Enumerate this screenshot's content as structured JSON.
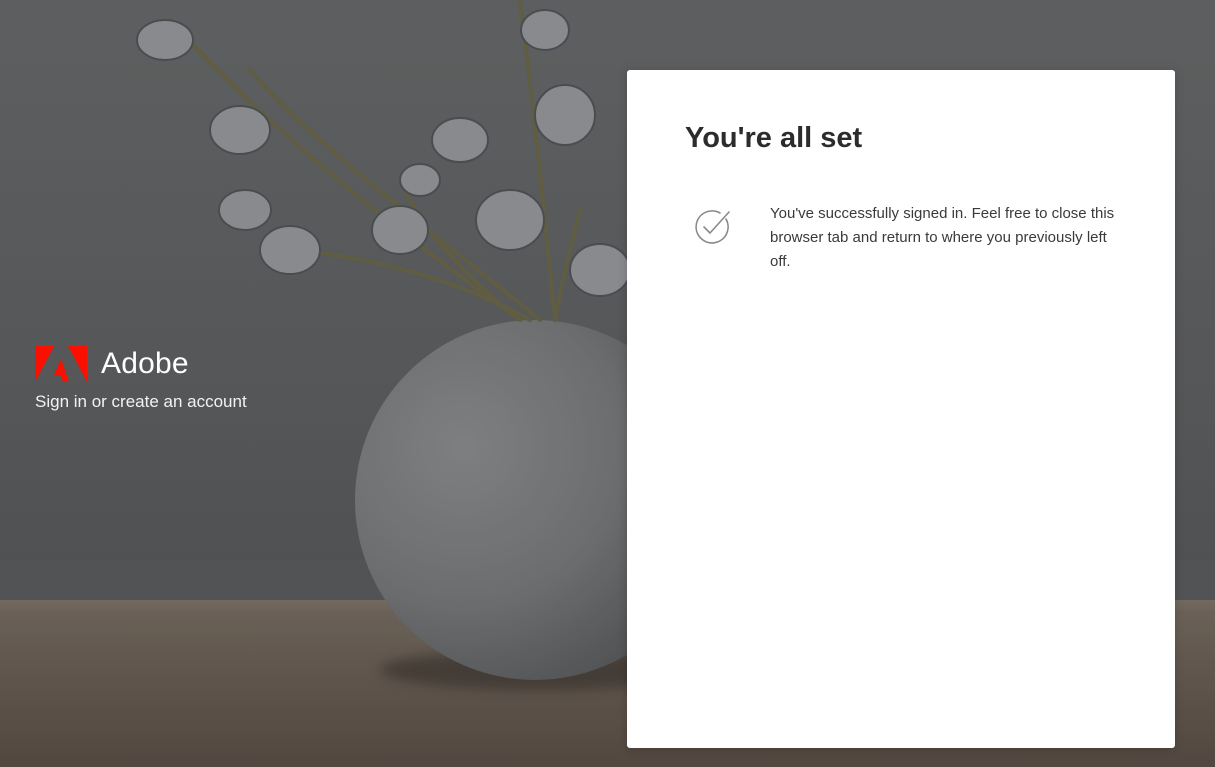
{
  "brand": {
    "name": "Adobe",
    "tagline": "Sign in or create an account",
    "logo_color": "#fa0f00"
  },
  "card": {
    "title": "You're all set",
    "message": "You've successfully signed in. Feel free to close this browser tab and return to where you previously left off.",
    "status_icon": "checkmark-circle-icon"
  },
  "colors": {
    "card_background": "#ffffff",
    "title_text": "#2c2c2c",
    "body_text": "#3a3a3a"
  }
}
